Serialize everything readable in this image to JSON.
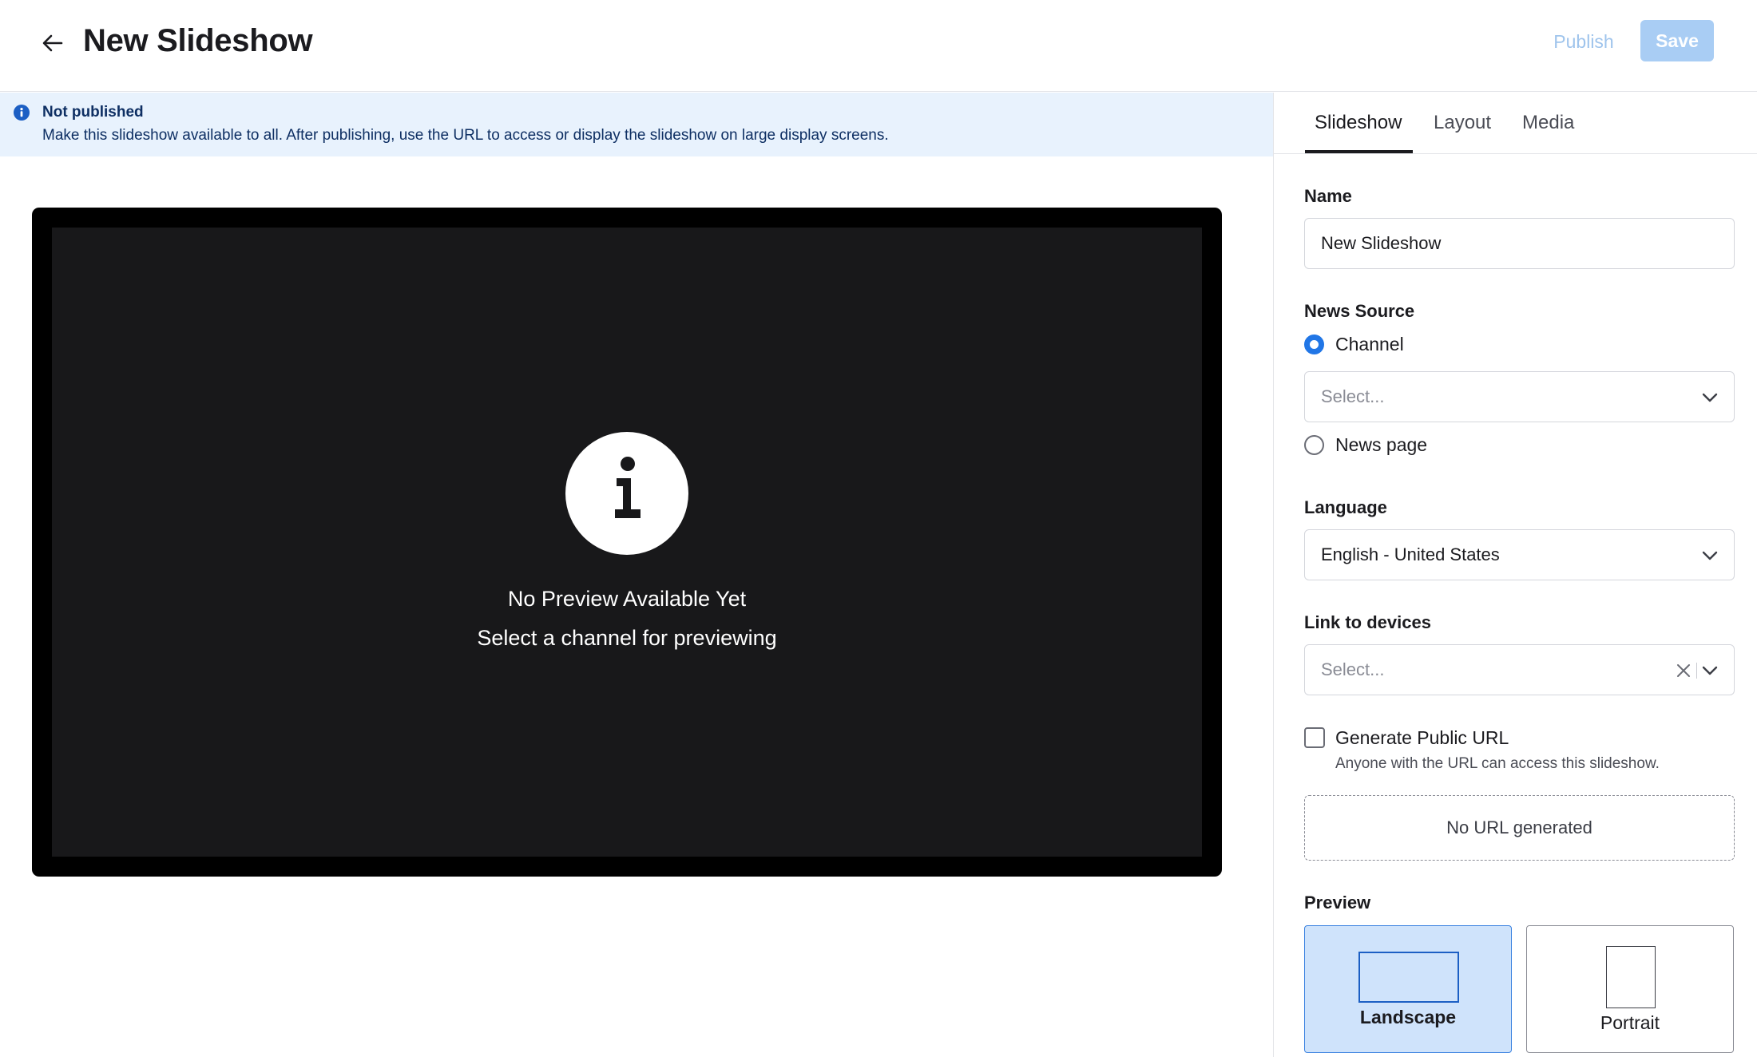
{
  "header": {
    "title": "New Slideshow",
    "publish_label": "Publish",
    "save_label": "Save"
  },
  "banner": {
    "title": "Not published",
    "text": "Make this slideshow available to all. After publishing, use the URL to access or display the slideshow on large display screens."
  },
  "preview": {
    "title": "No Preview Available Yet",
    "subtitle": "Select a channel for previewing"
  },
  "tabs": [
    {
      "label": "Slideshow",
      "active": true
    },
    {
      "label": "Layout",
      "active": false
    },
    {
      "label": "Media",
      "active": false
    }
  ],
  "form": {
    "name_label": "Name",
    "name_value": "New Slideshow",
    "news_source_label": "News Source",
    "channel_option": "Channel",
    "channel_placeholder": "Select...",
    "news_page_option": "News page",
    "language_label": "Language",
    "language_value": "English - United States",
    "devices_label": "Link to devices",
    "devices_placeholder": "Select...",
    "public_url_label": "Generate Public URL",
    "public_url_help": "Anyone with the URL can access this slideshow.",
    "url_box_text": "No URL generated",
    "preview_label": "Preview",
    "landscape_label": "Landscape",
    "portrait_label": "Portrait"
  },
  "colors": {
    "accent": "#2176e6",
    "banner_bg": "#e8f2fd",
    "banner_text": "#0e2f63",
    "save_disabled": "#a9cdf4",
    "selected_card": "#cfe3fb"
  },
  "icons": [
    "arrow-left-icon",
    "info-icon",
    "chevron-down-icon",
    "clear-x-icon"
  ]
}
